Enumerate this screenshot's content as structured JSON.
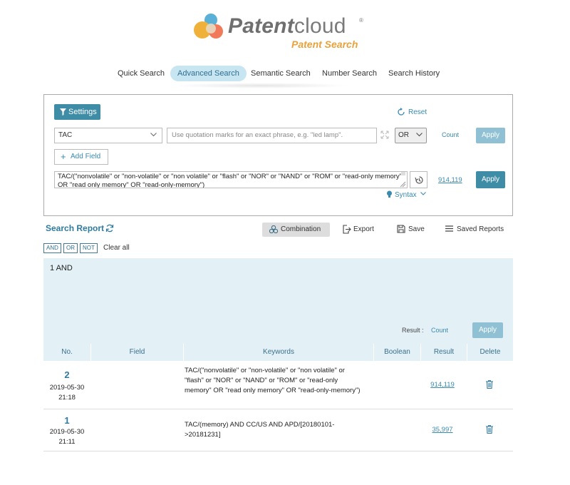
{
  "brand": {
    "name_bold": "Patent",
    "name_light": "cloud",
    "reg": "®",
    "subtitle": "Patent Search"
  },
  "tabs": [
    {
      "label": "Quick Search",
      "active": false
    },
    {
      "label": "Advanced Search",
      "active": true
    },
    {
      "label": "Semantic Search",
      "active": false
    },
    {
      "label": "Number Search",
      "active": false
    },
    {
      "label": "Search History",
      "active": false
    }
  ],
  "panel": {
    "settings_label": "Settings",
    "reset_label": "Reset",
    "field_select": "TAC",
    "keyword_placeholder": "Use quotation marks for an exact phrase, e.g. \"led lamp\".",
    "boolean_select": "OR",
    "count_label": "Count",
    "apply_label": "Apply",
    "add_field_label": "Add Field",
    "query_text": "TAC/(\"nonvolatile\" or \"non-volatile\" or \"non volatile\" or \"flash\" or \"NOR\" or \"NAND\" or \"ROM\" or \"read-only memory\" OR \"read only memory\" OR \"read-only-memory\")",
    "query_result": "914,119",
    "query_apply_label": "Apply",
    "syntax_label": "Syntax"
  },
  "report": {
    "title": "Search Report",
    "combination_label": "Combination",
    "export_label": "Export",
    "save_label": "Save",
    "saved_reports_label": "Saved Reports",
    "chips": [
      "AND",
      "OR",
      "NOT"
    ],
    "clear_all_label": "Clear all",
    "combination_text": "1 AND",
    "result_label": "Result :",
    "count_label": "Count",
    "apply_label": "Apply"
  },
  "table": {
    "headers": [
      "No.",
      "Field",
      "Keywords",
      "Boolean",
      "Result",
      "Delete"
    ],
    "rows": [
      {
        "no": "2",
        "date": "2019-05-30",
        "time": "21:18",
        "field": "",
        "keywords": "TAC/(\"nonvolatile\" or \"non-volatile\" or \"non volatile\" or \"flash\" or \"NOR\" or \"NAND\" or \"ROM\" or \"read-only memory\" OR \"read only memory\" OR \"read-only-memory\")",
        "boolean": "",
        "result": "914,119"
      },
      {
        "no": "1",
        "date": "2019-05-30",
        "time": "21:11",
        "field": "",
        "keywords": "TAC/(memory) AND CC/US AND APD/[20180101->20181231]",
        "boolean": "",
        "result": "35,997"
      }
    ]
  },
  "colors": {
    "primary": "#3f8ca6",
    "primary_dim": "#8fc0d4",
    "link": "#3a8ab0",
    "tab_active_bg": "#c8e5f2",
    "light_panel": "#e3f1f7",
    "accent": "#e9a23b"
  }
}
